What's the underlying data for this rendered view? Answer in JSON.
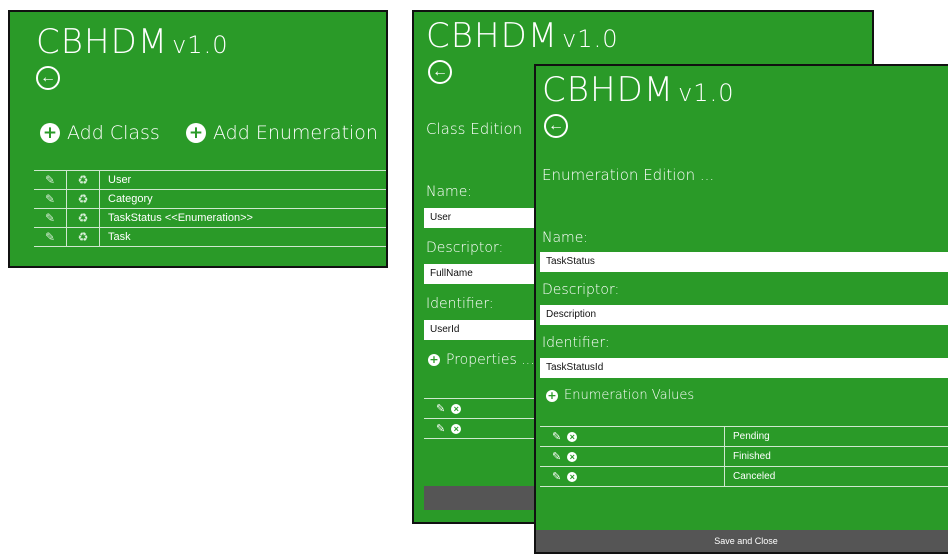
{
  "app": {
    "title": "CBHDM",
    "version": "v1.0"
  },
  "icons": {
    "back": "back-arrow-icon",
    "edit": "pencil-icon",
    "delete": "trash-icon",
    "add": "plus-circle-icon",
    "remove": "x-circle-icon"
  },
  "colors": {
    "green": "#2a9a28",
    "dark_bar": "#555555"
  },
  "list_panel": {
    "add_class": "Add Class",
    "add_enumeration": "Add Enumeration",
    "rows": [
      "User",
      "Category",
      "TaskStatus <<Enumeration>>",
      "Task"
    ]
  },
  "class_panel": {
    "heading": "Class Edition",
    "name_label": "Name:",
    "name_value": "User",
    "descriptor_label": "Descriptor:",
    "descriptor_value": "FullName",
    "identifier_label": "Identifier:",
    "identifier_value": "UserId",
    "properties_label": "Properties ..."
  },
  "enum_panel": {
    "heading": "Enumeration Edition ...",
    "name_label": "Name:",
    "name_value": "TaskStatus",
    "descriptor_label": "Descriptor:",
    "descriptor_value": "Description",
    "identifier_label": "Identifier:",
    "identifier_value": "TaskStatusId",
    "values_label": "Enumeration Values",
    "values": [
      "Pending",
      "Finished",
      "Canceled"
    ],
    "save_label": "Save and Close"
  }
}
